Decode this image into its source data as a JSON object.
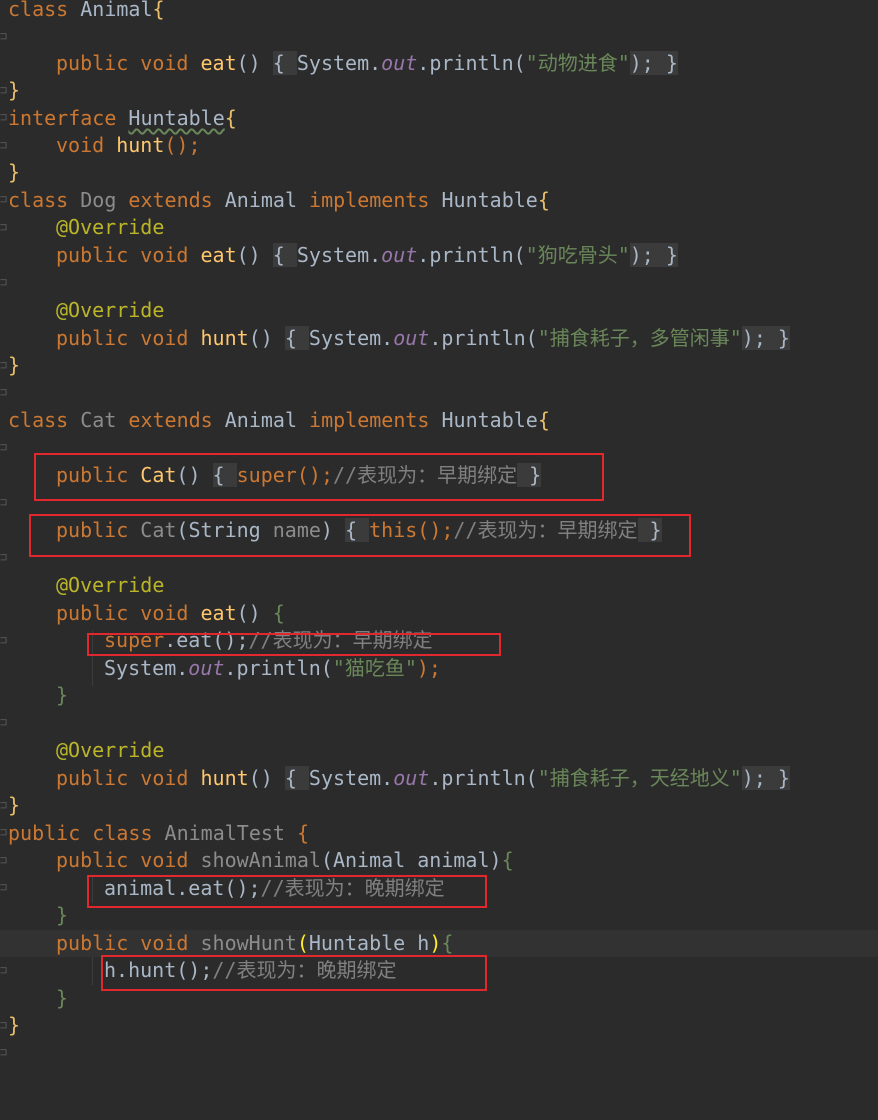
{
  "code": {
    "l01": {
      "a": "class ",
      "b": "Animal",
      "c": "{"
    },
    "l02": {
      "a": "public ",
      "b": "void ",
      "c": "eat",
      "d": "() ",
      "e": "{ ",
      "f": "System.",
      "g": "out",
      ".h": "",
      "h": ".println(",
      "i": "\"动物进食\"",
      "j": "); ",
      "k": "}"
    },
    "l03": {
      "a": "}"
    },
    "l04": {
      "a": "interface ",
      "b": "Huntable",
      "c": "{"
    },
    "l05": {
      "a": "void ",
      "b": "hunt",
      "c": "();"
    },
    "l06": {
      "a": "}"
    },
    "l07": {
      "a": "class ",
      "b": "Dog ",
      "c": "extends ",
      "d": "Animal ",
      "e": "implements ",
      "f": "Huntable",
      "g": "{"
    },
    "l08": {
      "a": "@Override"
    },
    "l09": {
      "a": "public ",
      "b": "void ",
      "c": "eat",
      "d": "() ",
      "e": "{ ",
      "f": "System.",
      "g": "out",
      "h": ".println(",
      "i": "\"狗吃骨头\"",
      "j": "); ",
      "k": "}"
    },
    "l10": {
      "a": "@Override"
    },
    "l11": {
      "a": "public ",
      "b": "void ",
      "c": "hunt",
      "d": "() ",
      "e": "{ ",
      "f": "System.",
      "g": "out",
      "h": ".println(",
      "i": "\"捕食耗子，多管闲事\"",
      "j": "); ",
      "k": "}"
    },
    "l12": {
      "a": "}"
    },
    "l13": {
      "a": "class ",
      "b": "Cat ",
      "c": "extends ",
      "d": "Animal ",
      "e": "implements ",
      "f": "Huntable",
      "g": "{"
    },
    "l14": {
      "a": "public ",
      "b": "Cat",
      "c": "() ",
      "d": "{ ",
      "e": "super",
      "f": "();",
      "g": "//表现为：早期绑定",
      "h": " }"
    },
    "l15": {
      "a": "public ",
      "b": "Cat",
      "c": "(String ",
      "d": "name",
      "e": ") ",
      "f": "{ ",
      "g": "this",
      "h": "();",
      "i": "//表现为：早期绑定",
      "j": " }"
    },
    "l16": {
      "a": "@Override"
    },
    "l17": {
      "a": "public ",
      "b": "void ",
      "c": "eat",
      "d": "() ",
      "e": "{"
    },
    "l18": {
      "a": "super",
      "b": ".eat();",
      "c": "//表现为：早期绑定"
    },
    "l19": {
      "a": "System.",
      "b": "out",
      "c": ".println(",
      "d": "\"猫吃鱼\"",
      "e": ");"
    },
    "l20": {
      "a": "}"
    },
    "l21": {
      "a": "@Override"
    },
    "l22": {
      "a": "public ",
      "b": "void ",
      "c": "hunt",
      "d": "() ",
      "e": "{ ",
      "f": "System.",
      "g": "out",
      "h": ".println(",
      "i": "\"捕食耗子，天经地义\"",
      "j": "); ",
      "k": "}"
    },
    "l23": {
      "a": "}"
    },
    "l24": {
      "a": "public ",
      "b": "class ",
      "c": "AnimalTest ",
      "d": "{"
    },
    "l25": {
      "a": "public ",
      "b": "void ",
      "c": "showAnimal",
      "d": "(Animal animal)",
      "e": "{"
    },
    "l26": {
      "a": "animal.eat();",
      "b": "//表现为：晚期绑定"
    },
    "l27": {
      "a": "}"
    },
    "l28": {
      "a": "public ",
      "b": "void ",
      "c": "showHunt",
      "d": "(",
      "e": "Huntable h",
      "f": ")",
      "g": "{"
    },
    "l29": {
      "a": "h.hunt();",
      "b": "//表现为：晚期绑定"
    },
    "l30": {
      "a": "}"
    },
    "l31": {
      "a": "}"
    }
  },
  "colors": {
    "background": "#2b2b2b",
    "keyword": "#cc7832",
    "method": "#ffc66d",
    "string": "#6a8759",
    "annotation": "#bbb529",
    "comment": "#808080",
    "static_field": "#9876aa",
    "highlight_box": "#e0282e"
  }
}
